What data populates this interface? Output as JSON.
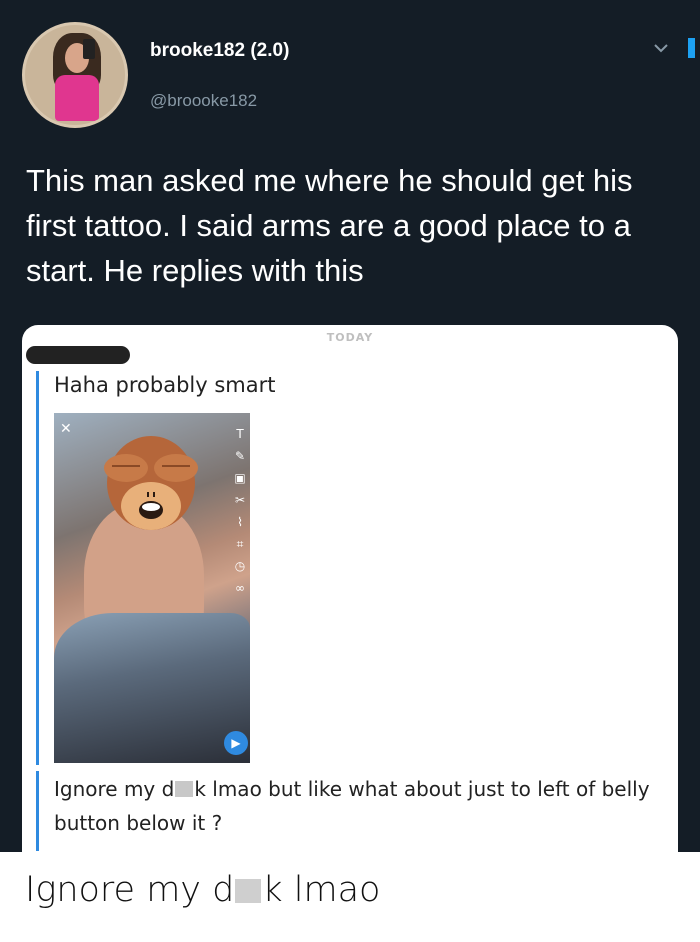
{
  "tweet": {
    "display_name": "brooke182 (2.0)",
    "handle": "@broooke182",
    "text": "This man asked me where he should get his first tattoo. I said arms are a good place to a start. He replies with this",
    "chevron_icon": "chevron-down-icon"
  },
  "chat": {
    "date_label": "TODAY",
    "message_1": "Haha probably smart",
    "snap_icons": [
      "close-icon",
      "text-icon",
      "pencil-icon",
      "sticker-icon",
      "scissors-icon",
      "paperclip-icon",
      "crop-icon",
      "timer-icon",
      "loop-icon",
      "send-icon"
    ],
    "message_2_before": "Ignore my d",
    "message_2_after": "k lmao but like what about just to left of belly button below it ?"
  },
  "caption": {
    "before": "Ignore my d",
    "after": "k lmao"
  },
  "colors": {
    "tweet_bg": "#141d26",
    "accent": "#2f8ae0",
    "handle": "#8899a6"
  }
}
